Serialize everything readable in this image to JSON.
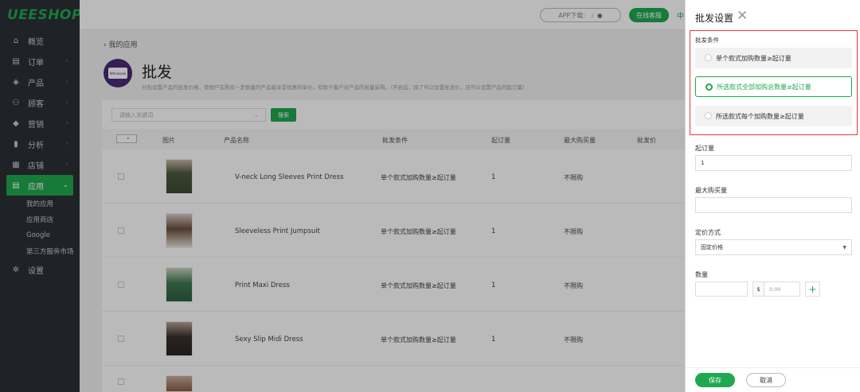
{
  "app": {
    "logo": "UEESHOP"
  },
  "sidebar": {
    "items": [
      {
        "label": "概览",
        "icon": "home-icon",
        "glyph": "⌂"
      },
      {
        "label": "订单",
        "icon": "order-icon",
        "glyph": "▤"
      },
      {
        "label": "产品",
        "icon": "product-icon",
        "glyph": "◈"
      },
      {
        "label": "顾客",
        "icon": "customers-icon",
        "glyph": "⚇"
      },
      {
        "label": "营销",
        "icon": "marketing-icon",
        "glyph": "◆"
      },
      {
        "label": "分析",
        "icon": "analytics-icon",
        "glyph": "▮"
      },
      {
        "label": "店铺",
        "icon": "store-icon",
        "glyph": "▦"
      },
      {
        "label": "应用",
        "icon": "apps-icon",
        "glyph": "▤"
      }
    ],
    "sub_items": [
      "我的应用",
      "应用商店",
      "Google",
      "第三方服务市场"
    ],
    "settings": {
      "label": "设置",
      "glyph": "✲"
    }
  },
  "topbar": {
    "app_download": "APP下载:",
    "online_service": "在线客服",
    "lang": "中"
  },
  "main": {
    "breadcrumb": "我的应用",
    "app_icon_text": "Wholesale",
    "title": "批发",
    "description": "分别设置产品的批发价格，使顾户在购买一定数量的产品能享受优惠的单价，有助于客户对产品的批量采购。（开启后，除了可以设置批发价，还可以设置产品的起订量）",
    "search_placeholder": "请输入关键词",
    "search_button": "搜索",
    "table": {
      "headers": [
        "图片",
        "产品名称",
        "批发条件",
        "起订量",
        "最大购买量",
        "批发价"
      ],
      "rows": [
        {
          "name": "V-neck Long Sleeves Print Dress",
          "condition": "单个款式加购数量≥起订量",
          "moq": "1",
          "max_buy": "不限购"
        },
        {
          "name": "Sleeveless Print Jumpsuit",
          "condition": "单个款式加购数量≥起订量",
          "moq": "1",
          "max_buy": "不限购"
        },
        {
          "name": "Print Maxi Dress",
          "condition": "单个款式加购数量≥起订量",
          "moq": "1",
          "max_buy": "不限购"
        },
        {
          "name": "Sexy Slip Midi Dress",
          "condition": "单个款式加购数量≥起订量",
          "moq": "1",
          "max_buy": "不限购"
        }
      ]
    }
  },
  "panel": {
    "title": "批发设置",
    "condition_label": "批发条件",
    "options": [
      "单个款式加购数量≥起订量",
      "所选款式全部加购总数量≥起订量",
      "所选款式每个加购数量≥起订量"
    ],
    "selected_option": 1,
    "moq_label": "起订量",
    "moq_value": "1",
    "max_buy_label": "最大购买量",
    "max_buy_value": "",
    "pricing_label": "定价方式",
    "pricing_value": "固定价格",
    "quantity_label": "数量",
    "currency": "$",
    "price_placeholder": "0.00",
    "save": "保存",
    "cancel": "取消"
  }
}
